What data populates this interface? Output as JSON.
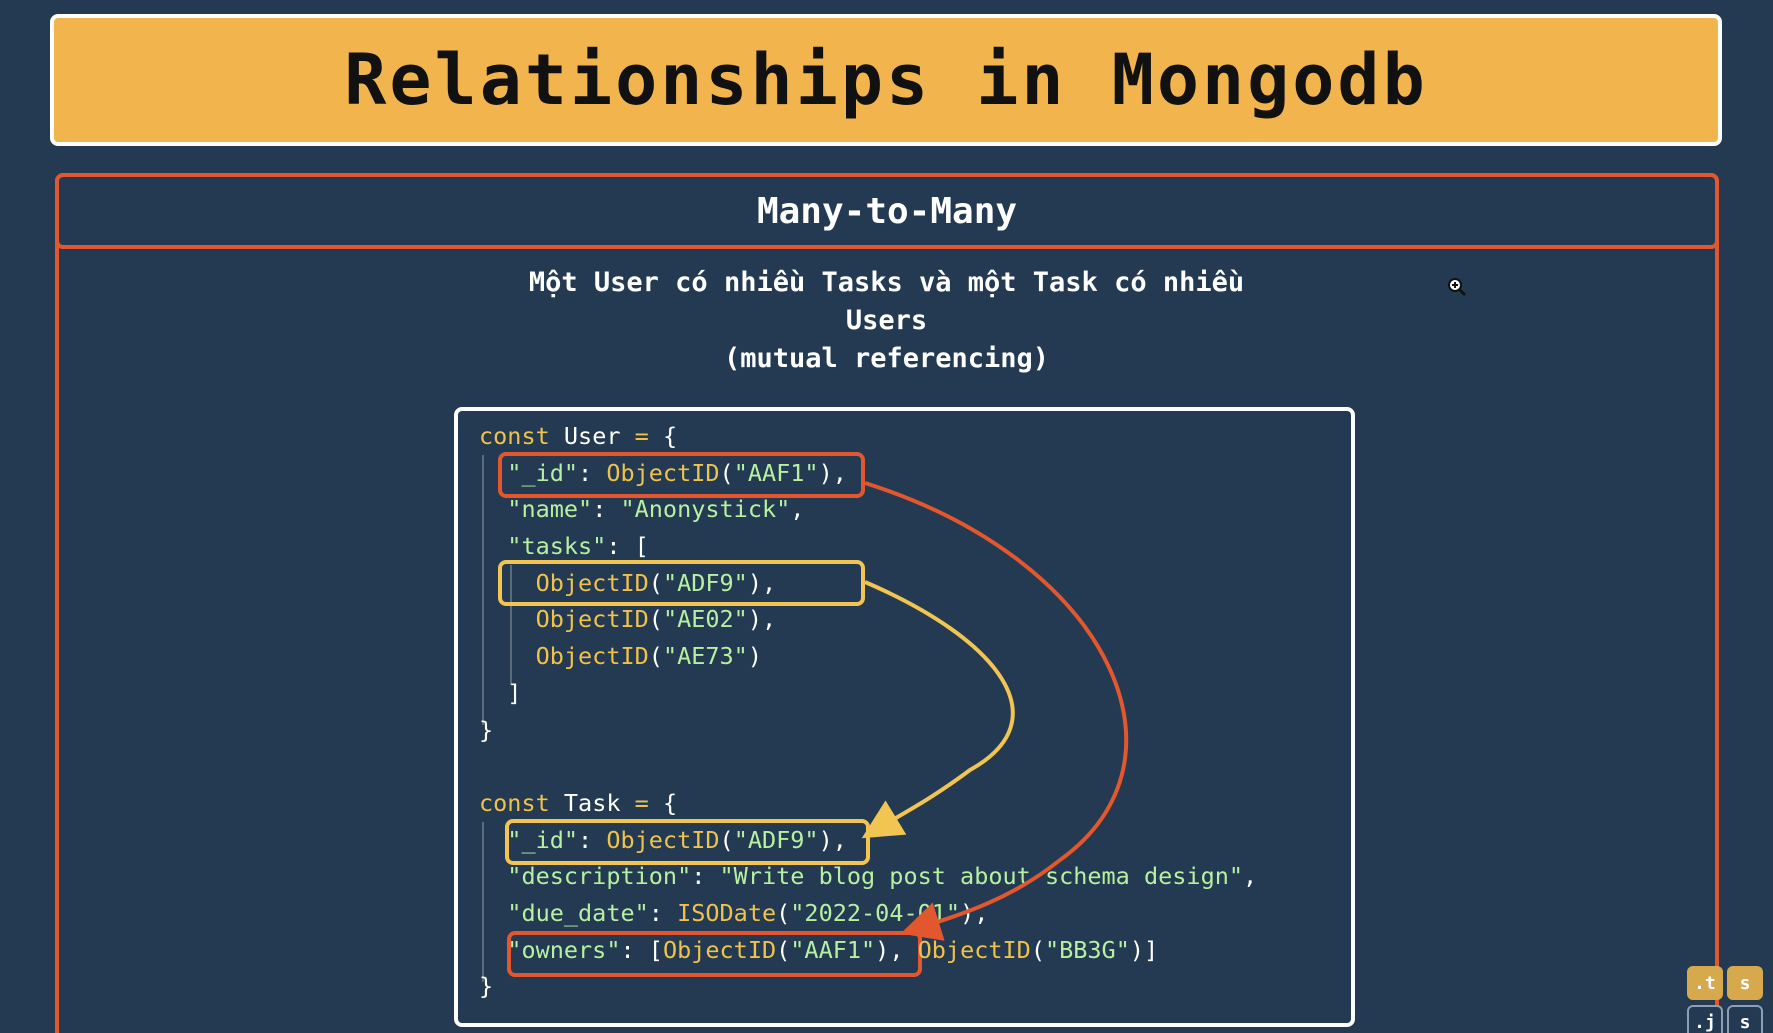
{
  "slide": {
    "title": "Relationships in Mongodb",
    "section_title": "Many-to-Many",
    "description_line1": "Một User có nhiều Tasks và một Task có nhiều",
    "description_line2": "Users",
    "description_line3": "(mutual referencing)"
  },
  "code": {
    "user": {
      "decl_keyword": "const",
      "decl_name": "User",
      "decl_op": "=",
      "open_brace": "{",
      "id_key": "\"_id\"",
      "id_fn": "ObjectID",
      "id_val": "\"AAF1\"",
      "name_key": "\"name\"",
      "name_val": "\"Anonystick\"",
      "tasks_key": "\"tasks\"",
      "task_fn": "ObjectID",
      "task_ids": [
        "\"ADF9\"",
        "\"AE02\"",
        "\"AE73\""
      ],
      "close_bracket": "]",
      "close_brace": "}"
    },
    "task": {
      "decl_keyword": "const",
      "decl_name": "Task",
      "decl_op": "=",
      "open_brace": "{",
      "id_key": "\"_id\"",
      "id_fn": "ObjectID",
      "id_val": "\"ADF9\"",
      "desc_key": "\"description\"",
      "desc_val": "\"Write blog post about schema design\"",
      "due_key": "\"due_date\"",
      "due_fn": "ISODate",
      "due_val": "\"2022-04-01\"",
      "owners_key": "\"owners\"",
      "owner_fn": "ObjectID",
      "owner_ids": [
        "\"AAF1\"",
        "\"BB3G\""
      ],
      "close_brace": "}"
    }
  },
  "colors": {
    "background": "#233a52",
    "banner": "#f2b54e",
    "frame_red": "#e2572d",
    "highlight_yellow": "#f2c451",
    "string_green": "#b6f0a0"
  },
  "icons": {
    "zoom": "zoom-in-icon"
  },
  "mini_buttons": [
    ".t",
    "s",
    ".j",
    "s"
  ]
}
